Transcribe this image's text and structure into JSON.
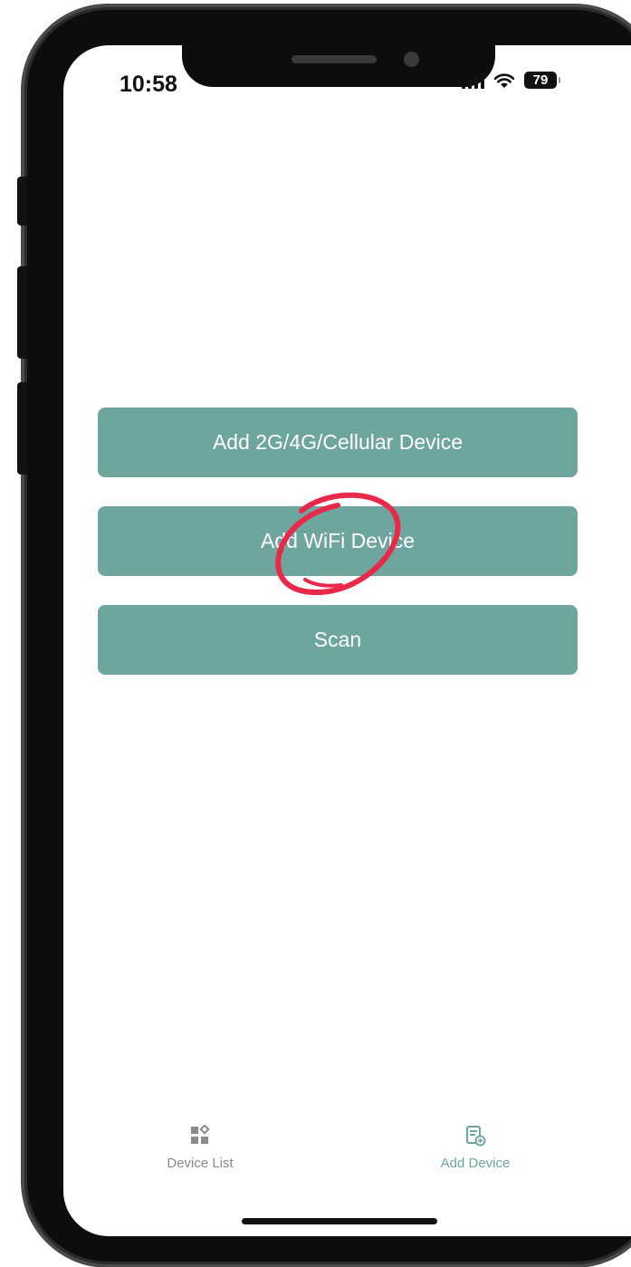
{
  "status_bar": {
    "time": "10:58",
    "battery": "79",
    "icons": [
      "signal-icon",
      "wifi-icon",
      "battery-icon"
    ]
  },
  "actions": {
    "add_cellular_label": "Add 2G/4G/Cellular Device",
    "add_wifi_label": "Add WiFi Device",
    "scan_label": "Scan"
  },
  "tab_bar": {
    "device_list_label": "Device List",
    "add_device_label": "Add Device",
    "active_tab": "Add Device"
  },
  "colors": {
    "accent": "#6fa59f",
    "annotation": "#e8294a",
    "tab_inactive": "#8a8a8a",
    "frame": "#0d0d0d"
  }
}
